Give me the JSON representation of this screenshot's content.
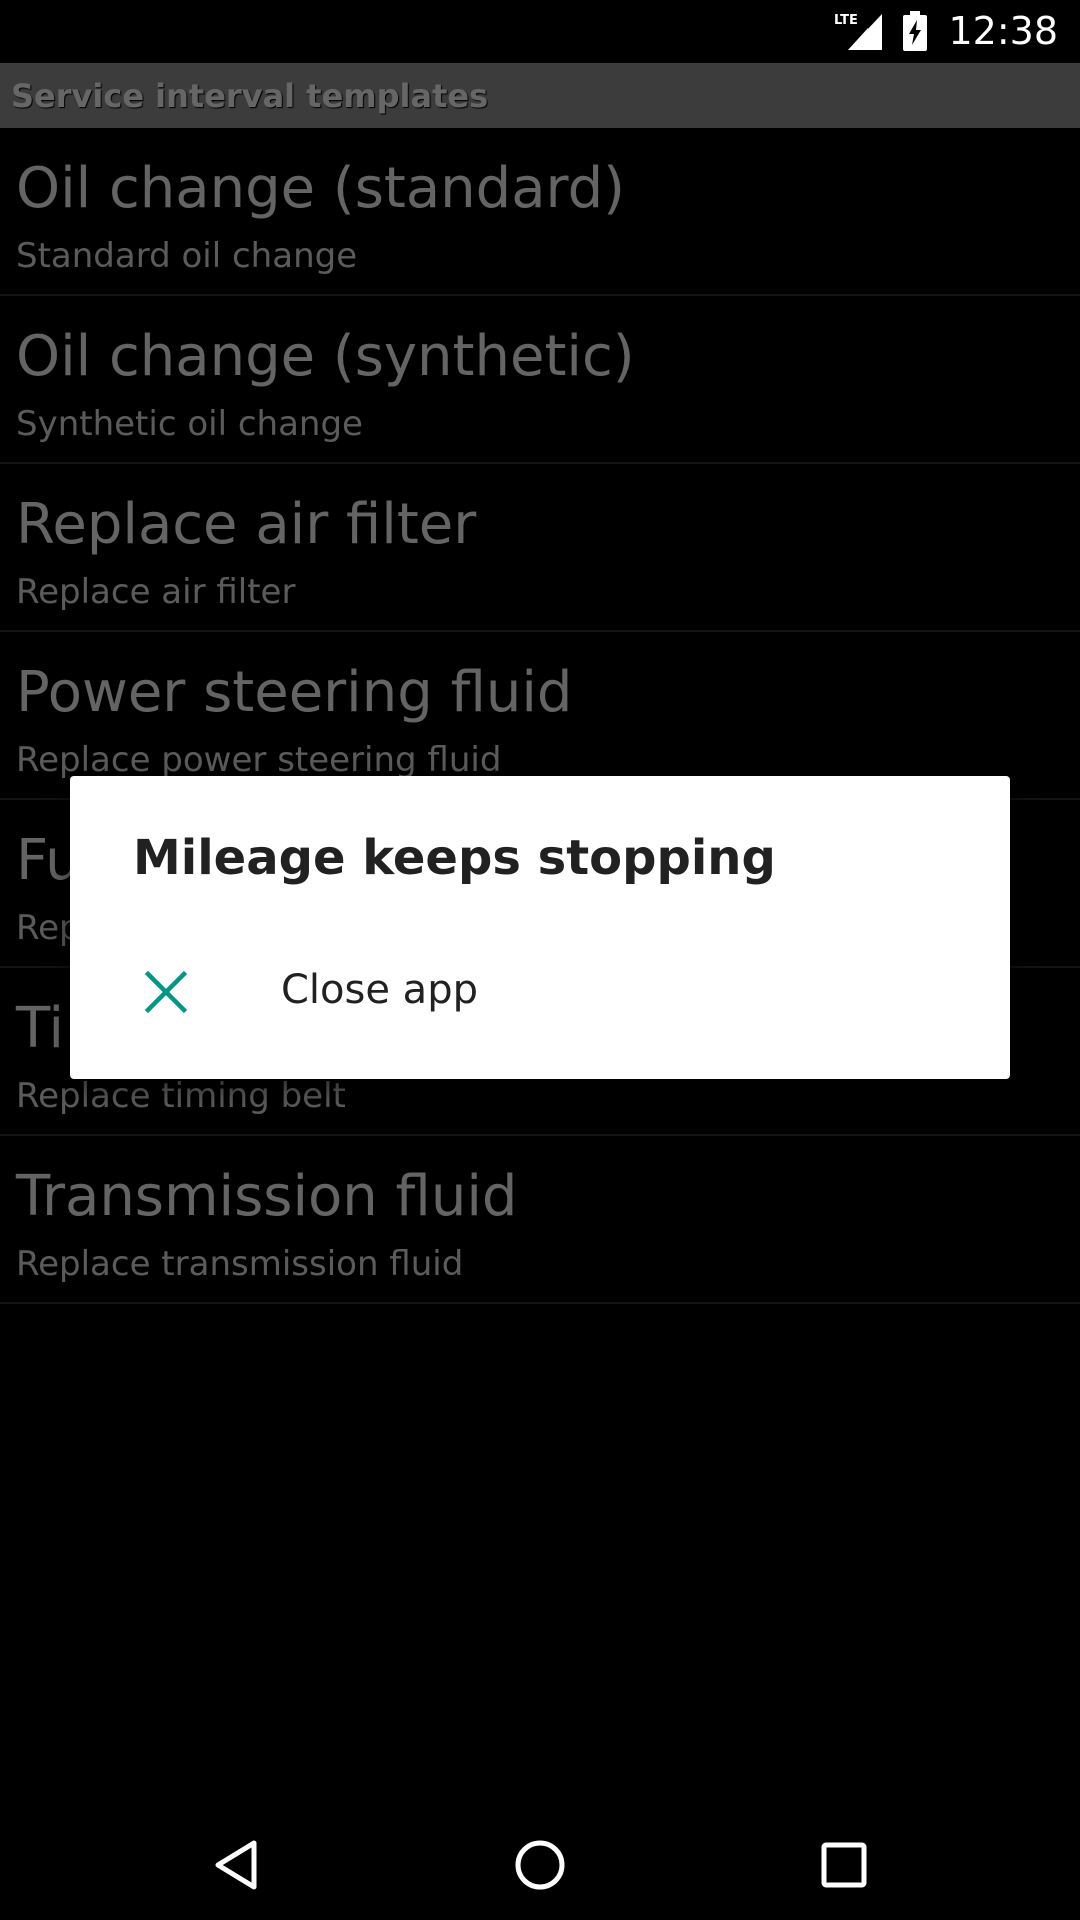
{
  "status_bar": {
    "time": "12:38",
    "network_label": "LTE",
    "icons": [
      "lte-signal-icon",
      "battery-charging-icon"
    ]
  },
  "app": {
    "title": "Service interval templates",
    "items": [
      {
        "title": "Oil change (standard)",
        "subtitle": "Standard oil change"
      },
      {
        "title": "Oil change (synthetic)",
        "subtitle": "Synthetic oil change"
      },
      {
        "title": "Replace air filter",
        "subtitle": "Replace air filter"
      },
      {
        "title": "Power steering fluid",
        "subtitle": "Replace power steering fluid"
      },
      {
        "title": "Fu",
        "subtitle": "Rep"
      },
      {
        "title": "Ti",
        "subtitle": "Replace timing belt"
      },
      {
        "title": "Transmission fluid",
        "subtitle": "Replace transmission fluid"
      }
    ]
  },
  "dialog": {
    "title": "Mileage keeps stopping",
    "action_label": "Close app",
    "action_icon": "close-icon",
    "accent_color": "#009688"
  },
  "nav_bar": {
    "icons": [
      "back-icon",
      "home-icon",
      "recents-icon"
    ]
  }
}
